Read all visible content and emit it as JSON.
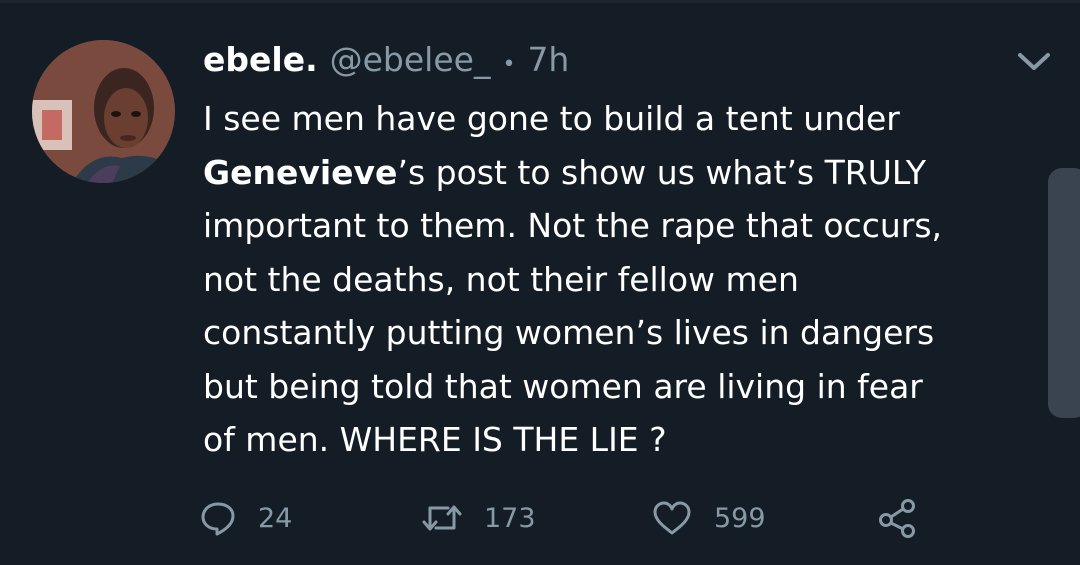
{
  "tweet": {
    "author_name": "ebele.",
    "author_handle": "@ebelee_",
    "separator": "•",
    "time": "7h",
    "body_lines": [
      {
        "pre": "I see men have gone to build a tent under",
        "bold": "",
        "post": ""
      },
      {
        "pre": "",
        "bold": "Genevieve",
        "post": "’s post to show us what’s TRULY"
      },
      {
        "pre": "important to them. Not the rape that occurs,",
        "bold": "",
        "post": ""
      },
      {
        "pre": "not the deaths, not their fellow men",
        "bold": "",
        "post": ""
      },
      {
        "pre": "constantly putting women’s lives in dangers",
        "bold": "",
        "post": ""
      },
      {
        "pre": "but being told that women are living in fear",
        "bold": "",
        "post": ""
      },
      {
        "pre": "of men. WHERE IS THE LIE ?",
        "bold": "",
        "post": ""
      }
    ],
    "reply_count": "24",
    "retweet_count": "173",
    "like_count": "599"
  },
  "icons": {
    "reply": "comment-icon",
    "retweet": "retweet-icon",
    "like": "heart-icon",
    "share": "share-icon",
    "menu": "chevron-down-icon"
  },
  "colors": {
    "background": "#141d26",
    "secondary_text": "#8899a6",
    "primary_text": "#ffffff"
  }
}
